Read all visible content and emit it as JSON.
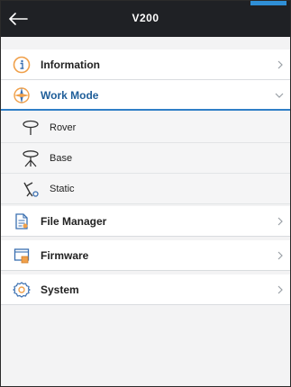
{
  "header": {
    "title": "V200"
  },
  "menu": {
    "information": {
      "label": "Information"
    },
    "work_mode": {
      "label": "Work Mode",
      "expanded": true
    },
    "sub_items": [
      {
        "label": "Rover"
      },
      {
        "label": "Base"
      },
      {
        "label": "Static"
      }
    ],
    "file_manager": {
      "label": "File Manager"
    },
    "firmware": {
      "label": "Firmware"
    },
    "system": {
      "label": "System"
    }
  },
  "colors": {
    "header_bg": "#1f2125",
    "accent_blue": "#2f8fd6",
    "active_text": "#1f5e99",
    "icon_orange": "#f0a04a"
  }
}
